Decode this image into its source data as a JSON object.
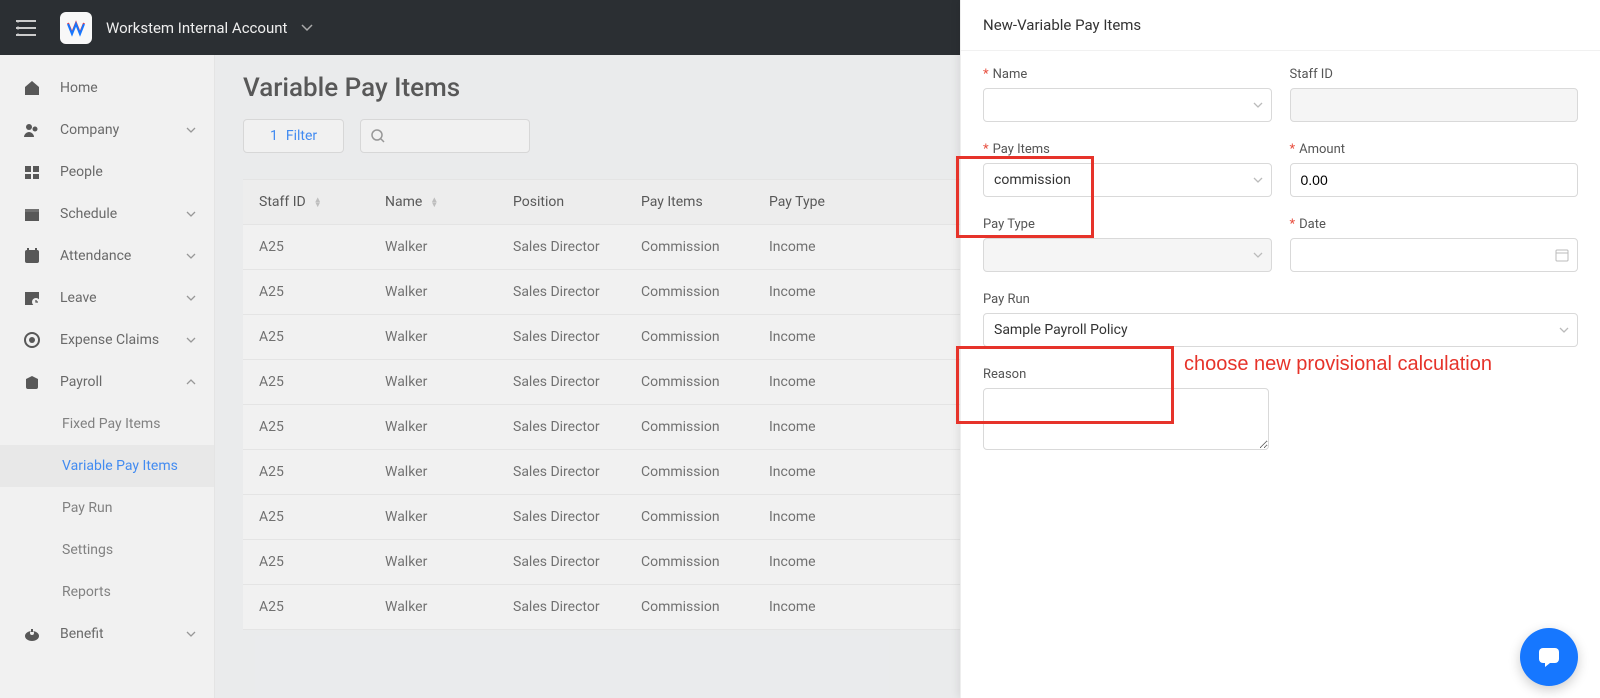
{
  "header": {
    "account_name": "Workstem Internal Account"
  },
  "sidebar": {
    "items": [
      {
        "icon": "home-icon",
        "label": "Home",
        "expandable": false
      },
      {
        "icon": "company-icon",
        "label": "Company",
        "expandable": true
      },
      {
        "icon": "people-icon",
        "label": "People",
        "expandable": false
      },
      {
        "icon": "schedule-icon",
        "label": "Schedule",
        "expandable": true
      },
      {
        "icon": "attendance-icon",
        "label": "Attendance",
        "expandable": true
      },
      {
        "icon": "leave-icon",
        "label": "Leave",
        "expandable": true
      },
      {
        "icon": "expense-icon",
        "label": "Expense Claims",
        "expandable": true
      },
      {
        "icon": "payroll-icon",
        "label": "Payroll",
        "expandable": true,
        "expanded": true
      },
      {
        "icon": "benefit-icon",
        "label": "Benefit",
        "expandable": true
      }
    ],
    "payroll_subitems": [
      {
        "label": "Fixed Pay Items",
        "active": false
      },
      {
        "label": "Variable Pay Items",
        "active": true
      },
      {
        "label": "Pay Run",
        "active": false
      },
      {
        "label": "Settings",
        "active": false
      },
      {
        "label": "Reports",
        "active": false
      }
    ]
  },
  "page": {
    "title": "Variable Pay Items",
    "filter_count": "1",
    "filter_label": "Filter"
  },
  "table": {
    "columns": [
      "Staff ID",
      "Name",
      "Position",
      "Pay Items",
      "Pay Type"
    ],
    "rows": [
      {
        "staff_id": "A25",
        "name": "Walker",
        "position": "Sales Director",
        "pay_item": "Commission",
        "pay_type": "Income"
      },
      {
        "staff_id": "A25",
        "name": "Walker",
        "position": "Sales Director",
        "pay_item": "Commission",
        "pay_type": "Income"
      },
      {
        "staff_id": "A25",
        "name": "Walker",
        "position": "Sales Director",
        "pay_item": "Commission",
        "pay_type": "Income"
      },
      {
        "staff_id": "A25",
        "name": "Walker",
        "position": "Sales Director",
        "pay_item": "Commission",
        "pay_type": "Income"
      },
      {
        "staff_id": "A25",
        "name": "Walker",
        "position": "Sales Director",
        "pay_item": "Commission",
        "pay_type": "Income"
      },
      {
        "staff_id": "A25",
        "name": "Walker",
        "position": "Sales Director",
        "pay_item": "Commission",
        "pay_type": "Income"
      },
      {
        "staff_id": "A25",
        "name": "Walker",
        "position": "Sales Director",
        "pay_item": "Commission",
        "pay_type": "Income"
      },
      {
        "staff_id": "A25",
        "name": "Walker",
        "position": "Sales Director",
        "pay_item": "Commission",
        "pay_type": "Income"
      },
      {
        "staff_id": "A25",
        "name": "Walker",
        "position": "Sales Director",
        "pay_item": "Commission",
        "pay_type": "Income"
      }
    ]
  },
  "drawer": {
    "title": "New-Variable Pay Items",
    "fields": {
      "name_label": "Name",
      "staff_id_label": "Staff ID",
      "pay_items_label": "Pay Items",
      "pay_items_value": "commission",
      "amount_label": "Amount",
      "amount_value": "0.00",
      "pay_type_label": "Pay Type",
      "date_label": "Date",
      "pay_run_label": "Pay Run",
      "pay_run_value": "Sample Payroll Policy",
      "reason_label": "Reason"
    }
  },
  "annotation": {
    "text": "choose new provisional calculation"
  }
}
